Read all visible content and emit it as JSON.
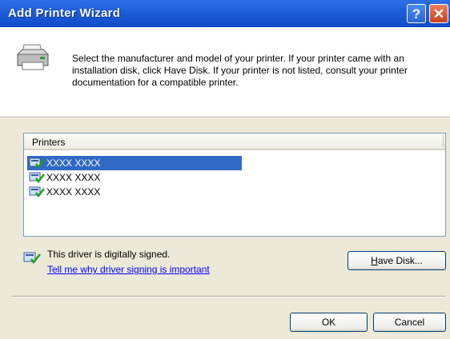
{
  "window": {
    "title": "Add Printer Wizard",
    "help_glyph": "?",
    "close_glyph": "✕"
  },
  "header": {
    "icon": "printer-icon",
    "text": "Select the manufacturer and model of your printer. If your printer came with an installation disk, click Have Disk. If your printer is not listed, consult your printer documentation for a compatible printer."
  },
  "printers": {
    "column_header": "Printers",
    "items": [
      {
        "label": "XXXX XXXX",
        "selected": true
      },
      {
        "label": "XXXX XXXX",
        "selected": false
      },
      {
        "label": "XXXX XXXX",
        "selected": false
      }
    ]
  },
  "driver": {
    "status_text": "This driver is digitally signed.",
    "link_text": "Tell me why driver signing is important"
  },
  "buttons": {
    "have_disk_accel": "H",
    "have_disk_rest": "ave Disk...",
    "ok": "OK",
    "cancel": "Cancel"
  },
  "colors": {
    "title_bar": "#1f5fd8",
    "selection": "#316ac5",
    "link": "#0000ff",
    "dialog_bg": "#ece9d8"
  }
}
